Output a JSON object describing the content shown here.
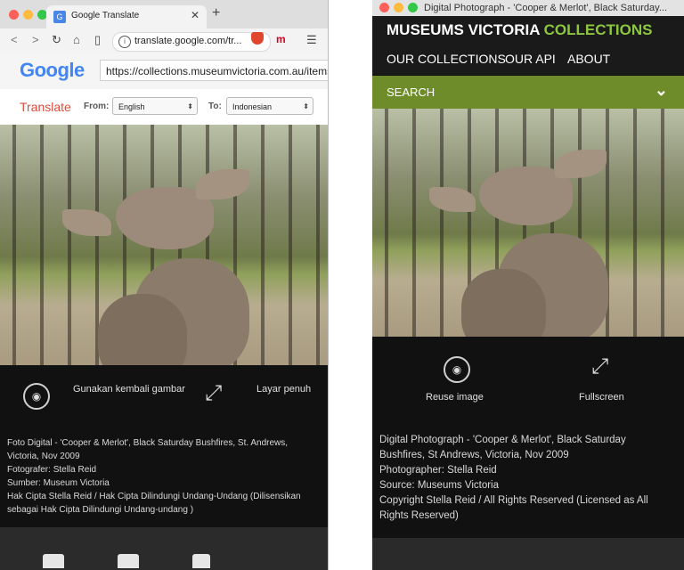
{
  "left": {
    "tab_title": "Google Translate",
    "address": "translate.google.com/tr...",
    "google_logo": "Google",
    "proxied_url": "https://collections.museumvictoria.com.au/items",
    "translate_label": "Translate",
    "from_label": "From:",
    "from_value": "English",
    "to_label": "To:",
    "to_value": "Indonesian",
    "reuse_label": "Gunakan kembali gambar",
    "fullscreen_label": "Layar penuh",
    "caption": [
      "Foto Digital - 'Cooper & Merlot', Black Saturday Bushfires, St. Andrews, Victoria, Nov 2009",
      "Fotografer: Stella Reid",
      "Sumber: Museum Victoria",
      "Hak Cipta Stella Reid / Hak Cipta Dilindungi Undang-Undang (Dilisensikan sebagai Hak Cipta Dilindungi Undang-undang )"
    ]
  },
  "right": {
    "window_title": "Digital Photograph - 'Cooper & Merlot', Black Saturday...",
    "brand_white": "MUSEUMS VICTORIA",
    "brand_green": "COLLECTIONS",
    "nav": [
      "OUR COLLECTIONS",
      "OUR API",
      "ABOUT"
    ],
    "search_label": "SEARCH",
    "reuse_label": "Reuse image",
    "fullscreen_label": "Fullscreen",
    "caption": [
      "Digital Photograph - 'Cooper & Merlot', Black Saturday Bushfires, St Andrews, Victoria, Nov 2009",
      "Photographer: Stella Reid",
      "Source: Museums Victoria",
      "Copyright Stella Reid / All Rights Reserved (Licensed as All Rights Reserved)"
    ]
  },
  "colors": {
    "brand_green": "#8dc63f",
    "search_bar": "#6f8c2a",
    "translate_red": "#dd4b39",
    "dark_bg": "#111111"
  },
  "icons": [
    "reuse-image-icon",
    "fullscreen-icon",
    "camera-icon",
    "video-icon",
    "audio-icon",
    "chevron-down-icon"
  ]
}
